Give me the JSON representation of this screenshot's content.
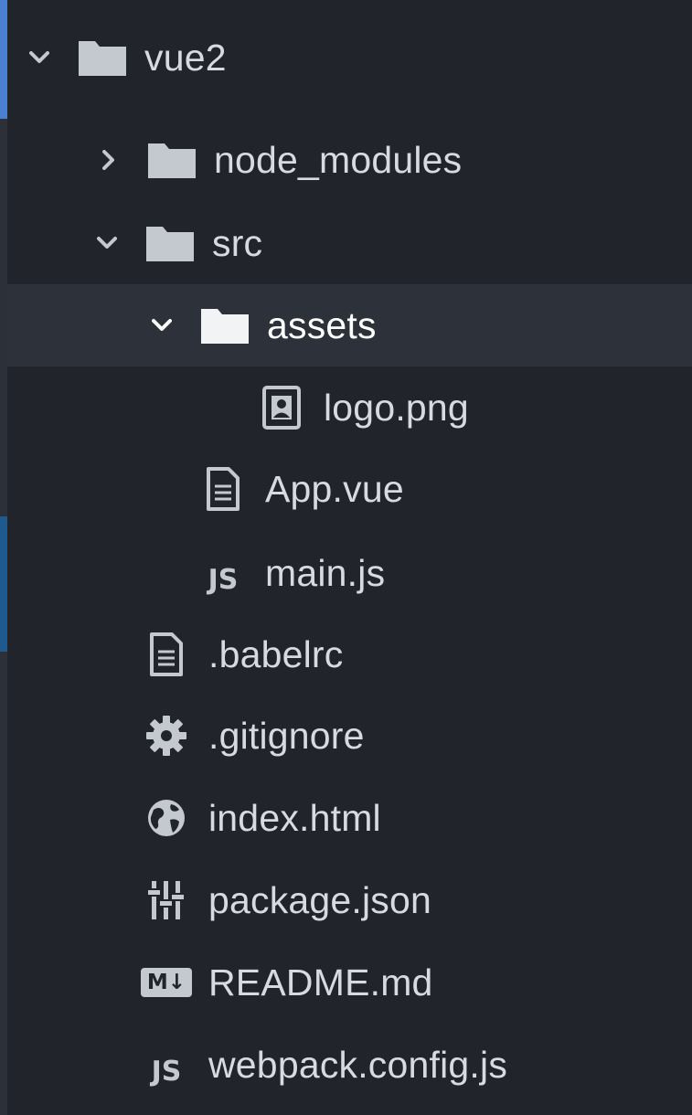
{
  "tree": {
    "root": {
      "label": "vue2",
      "icon": "folder-icon",
      "expanded": true
    },
    "items": [
      {
        "label": "node_modules",
        "icon": "folder-icon",
        "expanded": false
      },
      {
        "label": "src",
        "icon": "folder-icon",
        "expanded": true
      },
      {
        "label": "assets",
        "icon": "folder-icon",
        "expanded": true,
        "selected": true
      },
      {
        "label": "logo.png",
        "icon": "image-file-icon"
      },
      {
        "label": "App.vue",
        "icon": "text-file-icon"
      },
      {
        "label": "main.js",
        "icon": "js-file-icon",
        "icon_text": "JS"
      },
      {
        "label": ".babelrc",
        "icon": "text-file-icon"
      },
      {
        "label": ".gitignore",
        "icon": "gear-icon"
      },
      {
        "label": "index.html",
        "icon": "globe-icon"
      },
      {
        "label": "package.json",
        "icon": "sliders-icon"
      },
      {
        "label": "README.md",
        "icon": "markdown-icon",
        "icon_text": "M↓"
      },
      {
        "label": "webpack.config.js",
        "icon": "js-file-icon",
        "icon_text": "JS"
      }
    ]
  },
  "colors": {
    "background": "#21252b",
    "selected_row": "#2c313a",
    "text": "#d7dae0",
    "icon": "#c4c8cf",
    "accent_blue": "#4a7fd1"
  }
}
